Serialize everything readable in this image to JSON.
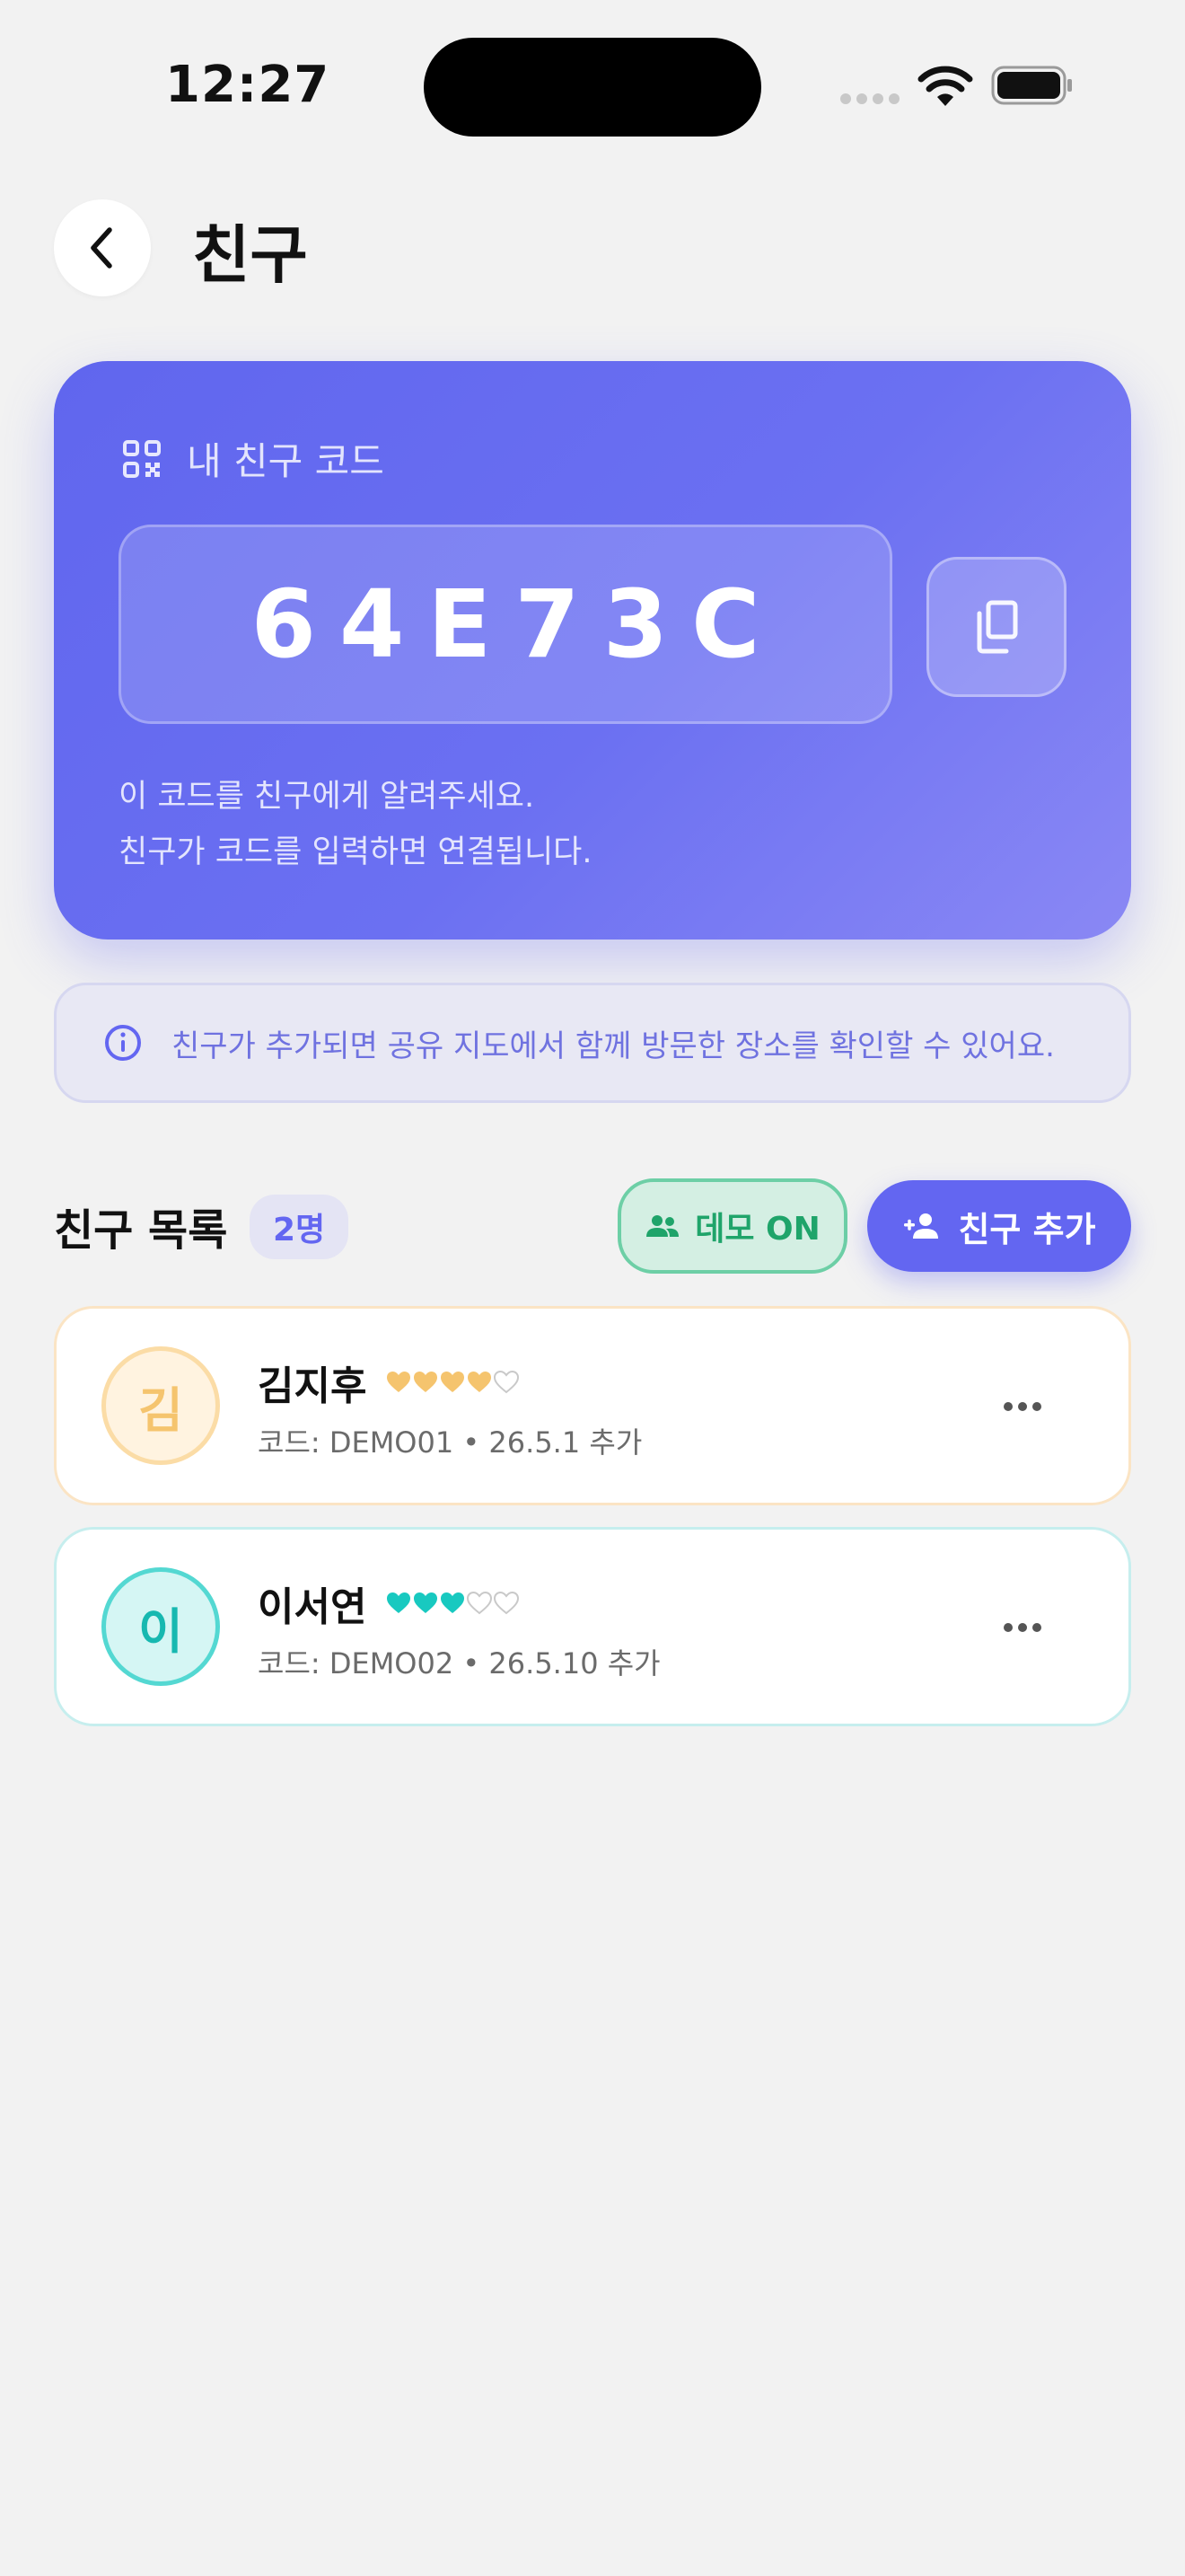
{
  "status_bar": {
    "time": "12:27"
  },
  "header": {
    "title": "친구"
  },
  "code_card": {
    "label": "내 친구 코드",
    "code": "64E73C",
    "help_line1": "이 코드를 친구에게 알려주세요.",
    "help_line2": "친구가 코드를 입력하면 연결됩니다."
  },
  "info_banner": {
    "text": "친구가 추가되면 공유 지도에서 함께 방문한 장소를 확인할 수 있어요."
  },
  "friends_section": {
    "title": "친구 목록",
    "count": "2명",
    "demo_label": "데모 ON",
    "add_label": "친구 추가"
  },
  "friends": [
    {
      "initial": "김",
      "name": "김지후",
      "hearts": 4,
      "hearts_max": 5,
      "heart_color": "#f5c46e",
      "meta": "코드: DEMO01 • 26.5.1 추가"
    },
    {
      "initial": "이",
      "name": "이서연",
      "hearts": 3,
      "hearts_max": 5,
      "heart_color": "#18c9c0",
      "meta": "코드: DEMO02 • 26.5.10 추가"
    }
  ],
  "colors": {
    "accent": "#6366f1",
    "demo_green": "#1fa46a",
    "background": "#f2f2f2"
  }
}
